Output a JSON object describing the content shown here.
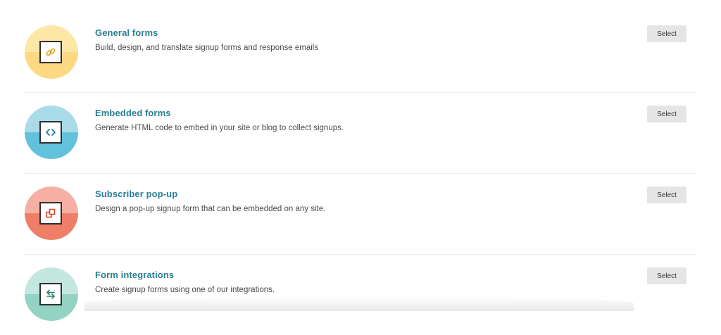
{
  "options": [
    {
      "title": "General forms",
      "description": "Build, design, and translate signup forms and response emails",
      "button_label": "Select",
      "icon": "link-icon",
      "color_light": "#fde7a6",
      "color_dark": "#fdd984"
    },
    {
      "title": "Embedded forms",
      "description": "Generate HTML code to embed in your site or blog to collect signups.",
      "button_label": "Select",
      "icon": "code-icon",
      "color_light": "#a9dbe9",
      "color_dark": "#62c1db"
    },
    {
      "title": "Subscriber pop-up",
      "description": "Design a pop-up signup form that can be embedded on any site.",
      "button_label": "Select",
      "icon": "popup-icon",
      "color_light": "#f6b0a3",
      "color_dark": "#ef7e68"
    },
    {
      "title": "Form integrations",
      "description": "Create signup forms using one of our integrations.",
      "button_label": "Select",
      "icon": "swap-arrows-icon",
      "color_light": "#c3e6de",
      "color_dark": "#94d3c4"
    }
  ]
}
